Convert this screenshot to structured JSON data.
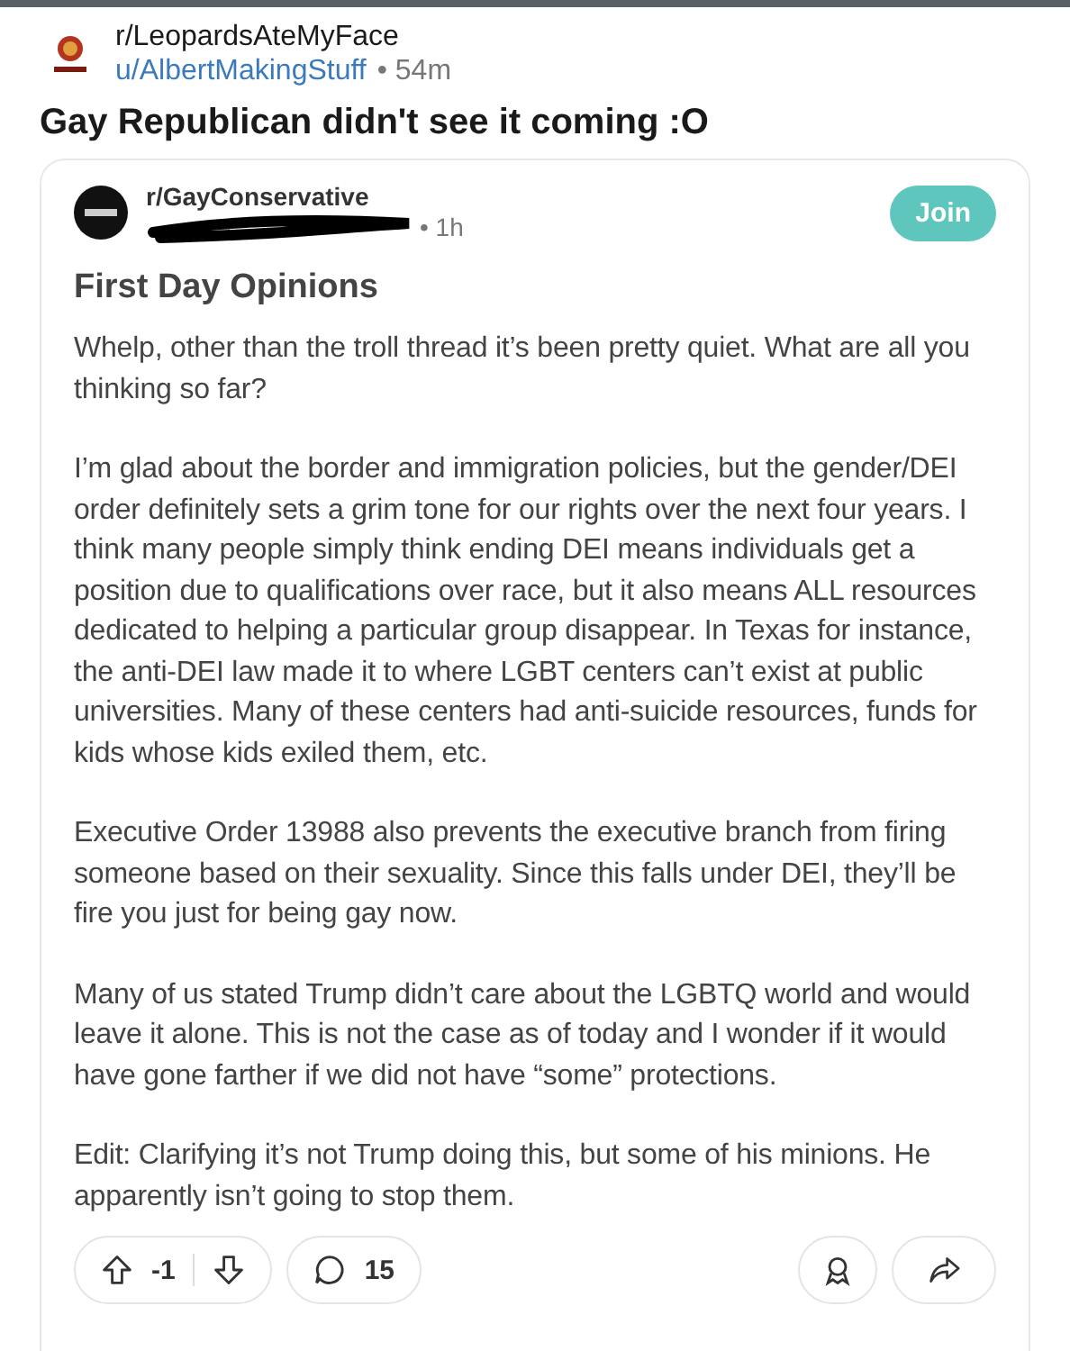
{
  "post": {
    "subreddit": "r/LeopardsAteMyFace",
    "author": "u/AlbertMakingStuff",
    "age": "• 54m",
    "title": "Gay Republican didn't see it coming :O"
  },
  "crosspost": {
    "subreddit": "r/GayConservative",
    "age": "• 1h",
    "join_label": "Join",
    "title": "First Day Opinions",
    "paragraphs": [
      "Whelp, other than the troll thread it’s been pretty quiet. What are all you thinking so far?",
      "I’m glad about the border and immigration policies, but the gender/DEI order definitely sets a grim tone for our rights over the next four years. I think many people simply think ending DEI means individuals get a position due to qualifications over race, but it also means ALL resources dedicated to helping a particular group disappear. In Texas for instance, the anti-DEI law made it to where LGBT centers can’t exist at public universities. Many of these centers had anti-suicide resources, funds for kids whose kids exiled them, etc.",
      "Executive Order 13988 also prevents the executive branch from firing someone based on their sexuality. Since this falls under DEI, they’ll be fire you just for being gay now.",
      "Many of us stated Trump didn’t care about the LGBTQ world and would leave it alone. This is not the case as of today and I wonder if it would have gone farther if we did not have “some” protections.",
      "Edit: Clarifying it’s not Trump doing this, but some of his minions. He apparently isn’t going to stop them."
    ],
    "score": "-1",
    "comments": "15"
  }
}
